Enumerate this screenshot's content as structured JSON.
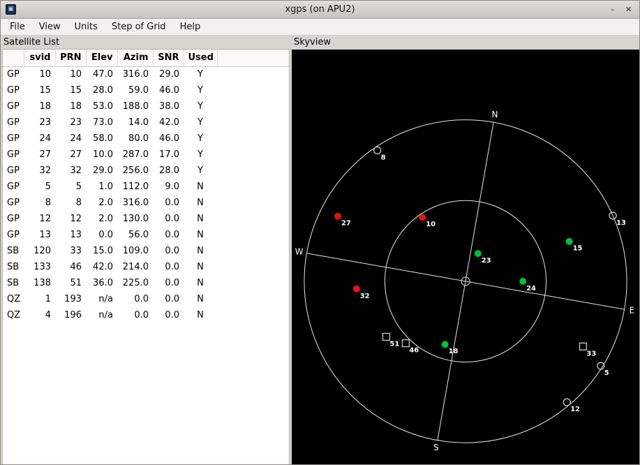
{
  "window": {
    "title": "xgps (on APU2)",
    "controls": {
      "minimize": "–",
      "close": "✕"
    }
  },
  "menubar": {
    "items": [
      "File",
      "View",
      "Units",
      "Step of Grid",
      "Help"
    ]
  },
  "satellite_list": {
    "frame_label": "Satellite List",
    "columns": [
      "",
      "svid",
      "PRN",
      "Elev",
      "Azim",
      "SNR",
      "Used"
    ],
    "rows": [
      [
        "GP",
        "10",
        "10",
        "47.0",
        "316.0",
        "29.0",
        "Y"
      ],
      [
        "GP",
        "15",
        "15",
        "28.0",
        "59.0",
        "46.0",
        "Y"
      ],
      [
        "GP",
        "18",
        "18",
        "53.0",
        "188.0",
        "38.0",
        "Y"
      ],
      [
        "GP",
        "23",
        "23",
        "73.0",
        "14.0",
        "42.0",
        "Y"
      ],
      [
        "GP",
        "24",
        "24",
        "58.0",
        "80.0",
        "46.0",
        "Y"
      ],
      [
        "GP",
        "27",
        "27",
        "10.0",
        "287.0",
        "17.0",
        "Y"
      ],
      [
        "GP",
        "32",
        "32",
        "29.0",
        "256.0",
        "28.0",
        "Y"
      ],
      [
        "GP",
        "5",
        "5",
        "1.0",
        "112.0",
        "9.0",
        "N"
      ],
      [
        "GP",
        "8",
        "8",
        "2.0",
        "316.0",
        "0.0",
        "N"
      ],
      [
        "GP",
        "12",
        "12",
        "2.0",
        "130.0",
        "0.0",
        "N"
      ],
      [
        "GP",
        "13",
        "13",
        "0.0",
        "56.0",
        "0.0",
        "N"
      ],
      [
        "SB",
        "120",
        "33",
        "15.0",
        "109.0",
        "0.0",
        "N"
      ],
      [
        "SB",
        "133",
        "46",
        "42.0",
        "214.0",
        "0.0",
        "N"
      ],
      [
        "SB",
        "138",
        "51",
        "36.0",
        "225.0",
        "0.0",
        "N"
      ],
      [
        "QZ",
        "1",
        "193",
        "n/a",
        "0.0",
        "0.0",
        "N"
      ],
      [
        "QZ",
        "4",
        "196",
        "n/a",
        "0.0",
        "0.0",
        "N"
      ]
    ]
  },
  "skyview": {
    "frame_label": "Skyview",
    "compass_labels": [
      "N",
      "E",
      "S",
      "W"
    ],
    "rotation_deg": 10,
    "snr_strong_threshold": 30,
    "colors": {
      "background": "#000000",
      "grid": "#e6e6e6",
      "label": "#ffffff",
      "used_strong": "#00c040",
      "used_weak": "#e01414",
      "unused_outline": "#c0c0c0"
    }
  },
  "chart_data": {
    "type": "scatter",
    "title": "Skyview satellite polar plot (elevation/azimuth)",
    "satellites": [
      {
        "gnss": "GP",
        "svid": 10,
        "prn": "10",
        "el": 47.0,
        "az": 316.0,
        "snr": 29.0,
        "used": true
      },
      {
        "gnss": "GP",
        "svid": 15,
        "prn": "15",
        "el": 28.0,
        "az": 59.0,
        "snr": 46.0,
        "used": true
      },
      {
        "gnss": "GP",
        "svid": 18,
        "prn": "18",
        "el": 53.0,
        "az": 188.0,
        "snr": 38.0,
        "used": true
      },
      {
        "gnss": "GP",
        "svid": 23,
        "prn": "23",
        "el": 73.0,
        "az": 14.0,
        "snr": 42.0,
        "used": true
      },
      {
        "gnss": "GP",
        "svid": 24,
        "prn": "24",
        "el": 58.0,
        "az": 80.0,
        "snr": 46.0,
        "used": true
      },
      {
        "gnss": "GP",
        "svid": 27,
        "prn": "27",
        "el": 10.0,
        "az": 287.0,
        "snr": 17.0,
        "used": true
      },
      {
        "gnss": "GP",
        "svid": 32,
        "prn": "32",
        "el": 29.0,
        "az": 256.0,
        "snr": 28.0,
        "used": true
      },
      {
        "gnss": "GP",
        "svid": 5,
        "prn": "5",
        "el": 1.0,
        "az": 112.0,
        "snr": 9.0,
        "used": false
      },
      {
        "gnss": "GP",
        "svid": 8,
        "prn": "8",
        "el": 2.0,
        "az": 316.0,
        "snr": 0.0,
        "used": false
      },
      {
        "gnss": "GP",
        "svid": 12,
        "prn": "12",
        "el": 2.0,
        "az": 130.0,
        "snr": 0.0,
        "used": false
      },
      {
        "gnss": "GP",
        "svid": 13,
        "prn": "13",
        "el": 0.0,
        "az": 56.0,
        "snr": 0.0,
        "used": false
      },
      {
        "gnss": "SB",
        "svid": 120,
        "prn": "33",
        "el": 15.0,
        "az": 109.0,
        "snr": 0.0,
        "used": false
      },
      {
        "gnss": "SB",
        "svid": 133,
        "prn": "46",
        "el": 42.0,
        "az": 214.0,
        "snr": 0.0,
        "used": false
      },
      {
        "gnss": "SB",
        "svid": 138,
        "prn": "51",
        "el": 36.0,
        "az": 225.0,
        "snr": 0.0,
        "used": false
      },
      {
        "gnss": "QZ",
        "svid": 1,
        "prn": "193",
        "el": null,
        "az": 0.0,
        "snr": 0.0,
        "used": false
      },
      {
        "gnss": "QZ",
        "svid": 4,
        "prn": "196",
        "el": null,
        "az": 0.0,
        "snr": 0.0,
        "used": false
      }
    ]
  }
}
